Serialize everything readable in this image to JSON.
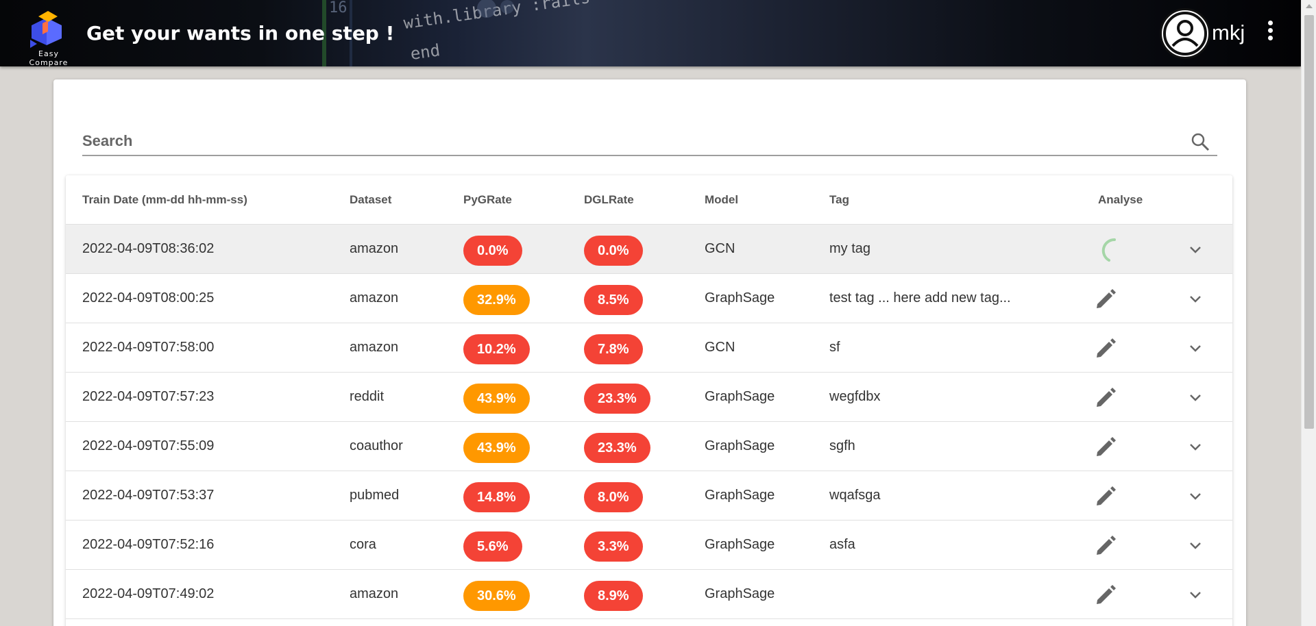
{
  "header": {
    "logo_text": "Easy Compare",
    "title": "Get your wants in one step !",
    "username": "mkj",
    "code_lines": [
      "with.library :rails",
      "end",
      "16"
    ]
  },
  "search": {
    "placeholder": "Search",
    "value": ""
  },
  "table": {
    "columns": [
      "Train Date (mm-dd hh-mm-ss)",
      "Dataset",
      "PyGRate",
      "DGLRate",
      "Model",
      "Tag",
      "Analyse"
    ],
    "rows": [
      {
        "date": "2022-04-09T08:36:02",
        "dataset": "amazon",
        "pyg": "0.0%",
        "pyg_status": "red",
        "dgl": "0.0%",
        "dgl_status": "red",
        "model": "GCN",
        "tag": "my tag",
        "analyse": "loading"
      },
      {
        "date": "2022-04-09T08:00:25",
        "dataset": "amazon",
        "pyg": "32.9%",
        "pyg_status": "orange",
        "dgl": "8.5%",
        "dgl_status": "red",
        "model": "GraphSage",
        "tag": "test tag ... here add new tag...",
        "analyse": "edit"
      },
      {
        "date": "2022-04-09T07:58:00",
        "dataset": "amazon",
        "pyg": "10.2%",
        "pyg_status": "red",
        "dgl": "7.8%",
        "dgl_status": "red",
        "model": "GCN",
        "tag": "sf",
        "analyse": "edit"
      },
      {
        "date": "2022-04-09T07:57:23",
        "dataset": "reddit",
        "pyg": "43.9%",
        "pyg_status": "orange",
        "dgl": "23.3%",
        "dgl_status": "red",
        "model": "GraphSage",
        "tag": "wegfdbx",
        "analyse": "edit"
      },
      {
        "date": "2022-04-09T07:55:09",
        "dataset": "coauthor",
        "pyg": "43.9%",
        "pyg_status": "orange",
        "dgl": "23.3%",
        "dgl_status": "red",
        "model": "GraphSage",
        "tag": "sgfh",
        "analyse": "edit"
      },
      {
        "date": "2022-04-09T07:53:37",
        "dataset": "pubmed",
        "pyg": "14.8%",
        "pyg_status": "red",
        "dgl": "8.0%",
        "dgl_status": "red",
        "model": "GraphSage",
        "tag": "wqafsga",
        "analyse": "edit"
      },
      {
        "date": "2022-04-09T07:52:16",
        "dataset": "cora",
        "pyg": "5.6%",
        "pyg_status": "red",
        "dgl": "3.3%",
        "dgl_status": "red",
        "model": "GraphSage",
        "tag": "asfa",
        "analyse": "edit"
      },
      {
        "date": "2022-04-09T07:49:02",
        "dataset": "amazon",
        "pyg": "30.6%",
        "pyg_status": "orange",
        "dgl": "8.9%",
        "dgl_status": "red",
        "model": "GraphSage",
        "tag": "",
        "analyse": "edit"
      }
    ]
  },
  "colors": {
    "red": "#f44336",
    "orange": "#ff9800",
    "spinner": "#a5d6a7"
  }
}
